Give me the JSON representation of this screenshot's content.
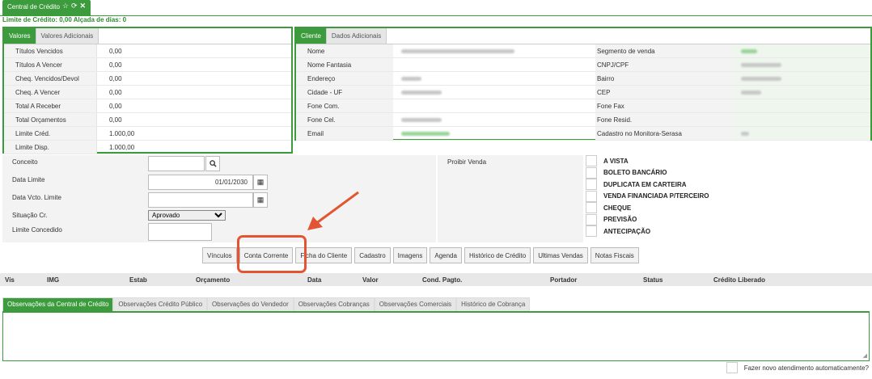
{
  "window": {
    "title": "Central de Crédito",
    "icons": [
      "star-icon",
      "refresh-icon",
      "close-icon"
    ]
  },
  "limit_line": "Limite de Crédito: 0,00 Alçada de dias: 0",
  "values_panel": {
    "tabs": [
      "Valores",
      "Valores Adicionais"
    ],
    "rows": [
      {
        "label": "Títulos Vencidos",
        "value": "0,00"
      },
      {
        "label": "Títulos A Vencer",
        "value": "0,00"
      },
      {
        "label": "Cheq. Vencidos/Devol",
        "value": "0,00"
      },
      {
        "label": "Cheq. A Vencer",
        "value": "0,00"
      },
      {
        "label": "Total A Receber",
        "value": "0,00"
      },
      {
        "label": "Total Orçamentos",
        "value": "0,00"
      },
      {
        "label": "Limite Créd.",
        "value": "1.000,00"
      },
      {
        "label": "Limite Disp.",
        "value": "1.000,00"
      }
    ]
  },
  "client_panel": {
    "tabs": [
      "Cliente",
      "Dados Adicionais"
    ],
    "rows": [
      {
        "label1": "Nome",
        "label2": "Segmento de venda"
      },
      {
        "label1": "Nome Fantasia",
        "label2": "CNPJ/CPF"
      },
      {
        "label1": "Endereço",
        "label2": "Bairro"
      },
      {
        "label1": "Cidade   -   UF",
        "label2": "CEP"
      },
      {
        "label1": "Fone Com.",
        "label2": "Fone Fax"
      },
      {
        "label1": "Fone Cel.",
        "label2": "Fone Resid."
      },
      {
        "label1": "Email",
        "label2": "Cadastro no Monitora-Serasa"
      }
    ]
  },
  "form": {
    "conceito_label": "Conceito",
    "data_limite_label": "Data Limite",
    "data_limite_value": "01/01/2030",
    "data_vcto_label": "Data Vcto. Limite",
    "situacao_label": "Situação Cr.",
    "situacao_value": "Aprovado",
    "limite_concedido_label": "Limite Concedido",
    "proibir_venda_label": "Proibir Venda"
  },
  "payment_options": [
    "A VISTA",
    "BOLETO BANCÁRIO",
    "DUPLICATA EM CARTEIRA",
    "VENDA FINANCIADA P/TERCEIRO",
    "CHEQUE",
    "PREVISÃO",
    "ANTECIPAÇÃO"
  ],
  "buttons": [
    "Vínculos",
    "Conta Corrente",
    "Ficha do Cliente",
    "Cadastro",
    "Imagens",
    "Agenda",
    "Histórico de Crédito",
    "Ultimas Vendas",
    "Notas Fiscais"
  ],
  "grid_columns": [
    "Vis",
    "IMG",
    "Estab",
    "Orçamento",
    "Data",
    "Valor",
    "Cond. Pagto.",
    "Portador",
    "Status",
    "Crédito Liberado"
  ],
  "obs_tabs": [
    "Observações da Central de Crédito",
    "Observações Crédito Público",
    "Observações do Vendedor",
    "Observações Cobranças",
    "Observações Comerciais",
    "Histórico de Cobrança"
  ],
  "footer_label": "Fazer novo atendimento automaticamente?",
  "colors": {
    "accent": "#3c9b3c",
    "highlight": "#e35532"
  }
}
